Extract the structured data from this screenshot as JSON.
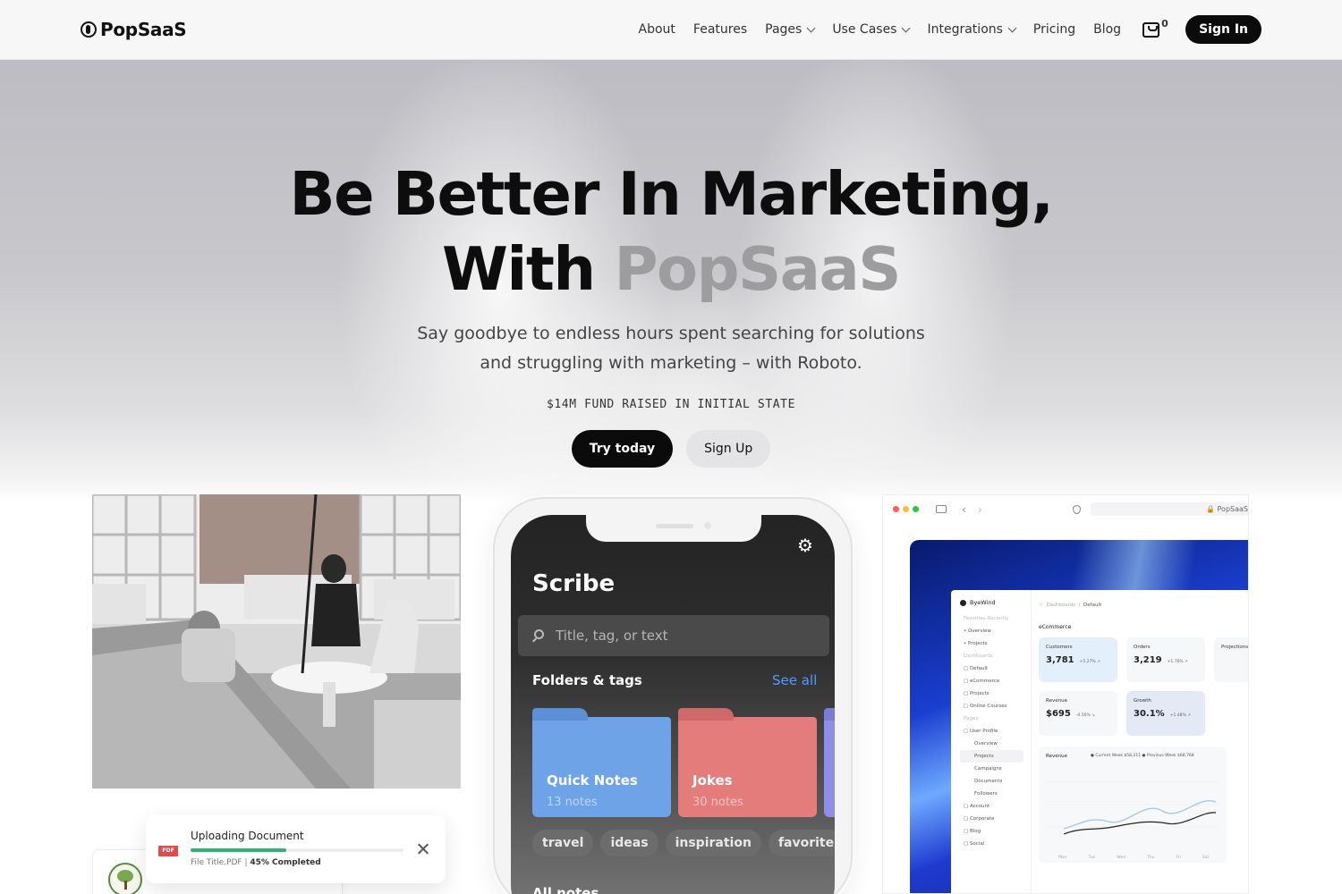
{
  "header": {
    "brand": "PopSaaS",
    "nav": [
      {
        "label": "About",
        "dropdown": false
      },
      {
        "label": "Features",
        "dropdown": false
      },
      {
        "label": "Pages",
        "dropdown": true
      },
      {
        "label": "Use Cases",
        "dropdown": true
      },
      {
        "label": "Integrations",
        "dropdown": true
      },
      {
        "label": "Pricing",
        "dropdown": false
      },
      {
        "label": "Blog",
        "dropdown": false
      }
    ],
    "cart_count": "0",
    "cart_icon": "shopping-bag-icon",
    "signin_label": "Sign In"
  },
  "hero": {
    "title_line1": "Be Better In Marketing,",
    "title_line2_prefix": "With ",
    "title_line2_accent": "PopSaaS",
    "subtitle": "Say goodbye to endless hours spent searching for solutions and struggling with marketing – with Roboto.",
    "fund_text": "$14M FUND RAISED IN INITIAL STATE",
    "primary_cta": "Try today",
    "secondary_cta": "Sign Up"
  },
  "upload": {
    "title": "Uploading Document",
    "file_type": "PDF",
    "file_name": "File Title.PDF",
    "separator": " | ",
    "progress_text": "45% Completed",
    "progress": 0.45
  },
  "phone": {
    "app_title": "Scribe",
    "search_placeholder": "Title, tag, or text",
    "folders_label": "Folders & tags",
    "see_all": "See all",
    "folders": [
      {
        "name": "Quick Notes",
        "count": "13 notes",
        "color": "#6fa3e8"
      },
      {
        "name": "Jokes",
        "count": "30 notes",
        "color": "#e47c7c"
      }
    ],
    "tags": [
      "travel",
      "ideas",
      "inspiration",
      "favorite"
    ],
    "all_notes": "All notes"
  },
  "dashboard": {
    "url": "PopSaaS",
    "brand": "ByeWind",
    "sidebar": [
      {
        "label": "Favorites   Recently",
        "style": "muted"
      },
      {
        "label": "Overview",
        "style": "bullet"
      },
      {
        "label": "Projects",
        "style": "bullet"
      },
      {
        "label": "Dashboards",
        "style": "muted"
      },
      {
        "label": "Default",
        "style": "item"
      },
      {
        "label": "eCommerce",
        "style": "item"
      },
      {
        "label": "Projects",
        "style": "item"
      },
      {
        "label": "Online Courses",
        "style": "item"
      },
      {
        "label": "Pages",
        "style": "muted"
      },
      {
        "label": "User Profile",
        "style": "item"
      },
      {
        "label": "Overview",
        "style": "indent"
      },
      {
        "label": "Projects",
        "style": "active"
      },
      {
        "label": "Campaigns",
        "style": "indent"
      },
      {
        "label": "Documents",
        "style": "indent"
      },
      {
        "label": "Followers",
        "style": "indent"
      },
      {
        "label": "Account",
        "style": "item"
      },
      {
        "label": "Corporate",
        "style": "item"
      },
      {
        "label": "Blog",
        "style": "item"
      },
      {
        "label": "Social",
        "style": "item"
      }
    ],
    "breadcrumb": {
      "root": "Dashboards",
      "sep": "/",
      "current": "Default"
    },
    "section_title": "eCommerce",
    "cards": [
      {
        "label": "Customers",
        "value": "3,781",
        "delta": "+5.27% ↗",
        "tone": "blue"
      },
      {
        "label": "Orders",
        "value": "3,219",
        "delta": "+1.76% ↗",
        "tone": "plain"
      },
      {
        "label": "Projections",
        "value": "",
        "delta": "",
        "tone": "plain"
      },
      {
        "label": "Revenue",
        "value": "$695",
        "delta": "-0.56% ↘",
        "tone": "plain"
      },
      {
        "label": "Growth",
        "value": "30.1%",
        "delta": "+1.48% ↗",
        "tone": "lav"
      }
    ],
    "chart_title": "Revenue",
    "chart_legend": "● Current Week $58,211     ● Previous Week $68,768",
    "chart_days": [
      "Mon",
      "Tue",
      "Wed",
      "Thu",
      "Fri",
      "Sat"
    ]
  }
}
